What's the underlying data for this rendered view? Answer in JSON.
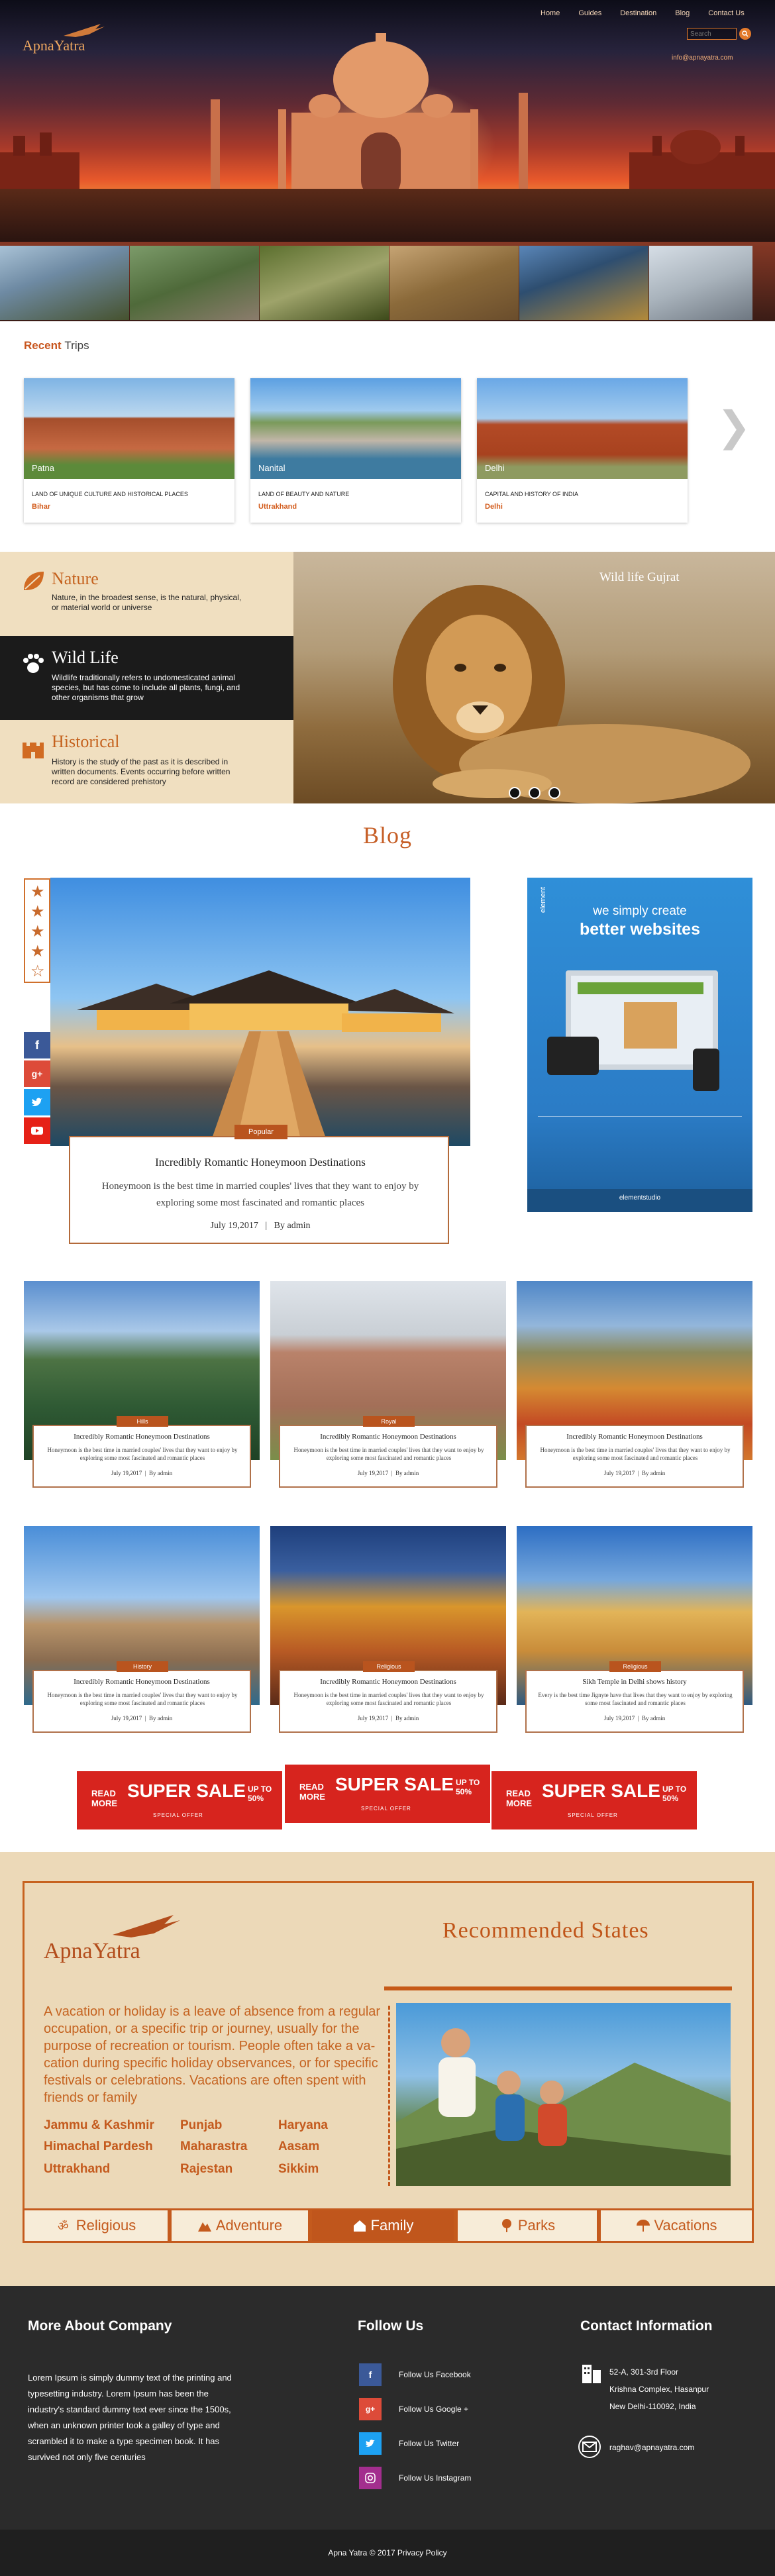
{
  "header": {
    "logo_text": "ApnaYatra",
    "nav": [
      "Home",
      "Guides",
      "Destination",
      "Blog",
      "Contact Us"
    ],
    "search_placeholder": "Search",
    "email": "info@apnayatra.com"
  },
  "recent": {
    "title_bold": "Recent",
    "title_rest": "Trips",
    "cards": [
      {
        "place": "Patna",
        "desc": "LAND OF UNIQUE CULTURE AND HISTORICAL PLACES",
        "state": "Bihar"
      },
      {
        "place": "Nanital",
        "desc": "LAND OF BEAUTY AND NATURE",
        "state": "Uttrakhand"
      },
      {
        "place": "Delhi",
        "desc": "CAPITAL AND HISTORY OF INDIA",
        "state": "Delhi"
      }
    ]
  },
  "categories": [
    {
      "title": "Nature",
      "body": "Nature, in the broadest sense, is the natural, physical, or material world or universe"
    },
    {
      "title": "Wild Life",
      "body": "Wildlife traditionally refers to undomesticated animal species, but has come to include all plants, fungi, and other organisms that grow"
    },
    {
      "title": "Historical",
      "body": "History is the study of the past as it is described in written documents. Events occurring before written record are considered prehistory"
    }
  ],
  "slider": {
    "caption": "Wild life Gujrat"
  },
  "blog": {
    "title": "Blog",
    "featured": {
      "tag": "Popular",
      "title": "Incredibly Romantic Honeymoon Destinations",
      "excerpt": "Honeymoon is the best time in married couples' lives that they want to enjoy by exploring some most fascinated and romantic places",
      "date": "July 19,2017",
      "sep": "|",
      "author": "By admin"
    },
    "ad": {
      "brand": "element",
      "line1": "we simply create",
      "line2": "better websites",
      "site": "elementstudio"
    },
    "posts": [
      {
        "tag": "Hills",
        "title": "Incredibly Romantic Honeymoon Destinations",
        "excerpt": "Honeymoon is the best time in married couples' lives that they want to enjoy by exploring some most fascinated and romantic places",
        "date": "July 19,2017",
        "author": "By admin"
      },
      {
        "tag": "Royal",
        "title": "Incredibly Romantic Honeymoon Destinations",
        "excerpt": "Honeymoon is the best time in married couples' lives that they want to enjoy by exploring some most fascinated and romantic places",
        "date": "July 19,2017",
        "author": "By admin"
      },
      {
        "tag": "",
        "title": "Incredibly Romantic Honeymoon Destinations",
        "excerpt": "Honeymoon is the best time in married couples' lives that they want to enjoy by exploring some most fascinated and romantic places",
        "date": "July 19,2017",
        "author": "By admin"
      },
      {
        "tag": "History",
        "title": "Incredibly Romantic Honeymoon Destinations",
        "excerpt": "Honeymoon is the best time in married couples' lives that they want to enjoy by exploring some most fascinated and romantic places",
        "date": "July 19,2017",
        "author": "By admin"
      },
      {
        "tag": "Religious",
        "title": "Incredibly Romantic Honeymoon Destinations",
        "excerpt": "Honeymoon is the best time in married couples' lives that they want to enjoy by exploring some most fascinated and romantic places",
        "date": "July 19,2017",
        "author": "By admin"
      },
      {
        "tag": "Religious",
        "title": "Sikh Temple in Delhi shows history",
        "excerpt": "Every is the best time Jignyte have that lives that they want to enjoy by exploring some most fascinated and romantic places",
        "date": "July 19,2017",
        "author": "By admin"
      }
    ]
  },
  "sale": {
    "read": "READ",
    "more": "MORE",
    "title": "SUPER SALE",
    "upto": "UP TO",
    "pct": "50%",
    "special": "SPECIAL OFFER"
  },
  "recommended": {
    "logo_text": "ApnaYatra",
    "title": "Recommended States",
    "text": "A vacation or holiday is a leave of absence from a regular occupation, or a specific trip or journey, usually for the purpose of recreation or tourism. People often take a va-cation during specific holiday observances, or for specific festivals or celebrations. Vacations are often spent with friends or family",
    "states": [
      [
        "Jammu & Kashmir",
        "Punjab",
        "Haryana"
      ],
      [
        "Himachal Pardesh",
        "Maharastra",
        "Aasam"
      ],
      [
        "Uttrakhand",
        "Rajestan",
        "Sikkim"
      ]
    ],
    "tabs": [
      "Religious",
      "Adventure",
      "Family",
      "Parks",
      "Vacations"
    ],
    "active_tab": "Family"
  },
  "footer": {
    "about_title": "More About Company",
    "about_body": "Lorem Ipsum is simply dummy text of the printing and typesetting industry. Lorem Ipsum has been the industry's standard dummy text ever since the 1500s, when an unknown printer took a galley of type and scrambled it to make a type specimen book. It has survived not only five centuries",
    "follow_title": "Follow Us",
    "follow": [
      "Follow Us Facebook",
      "Follow Us Google +",
      "Follow Us Twitter",
      "Follow Us Instagram"
    ],
    "contact_title": "Contact Information",
    "address": [
      "52-A, 301-3rd Floor",
      "Krishna Complex, Hasanpur",
      "New Delhi-110092, India"
    ],
    "email": "raghav@apnayatra.com",
    "copyright": "Apna Yatra © 2017 Privacy Policy"
  },
  "colors": {
    "accent": "#c65a18",
    "cream": "#ecd9b8",
    "footer": "#2b2b2b"
  }
}
